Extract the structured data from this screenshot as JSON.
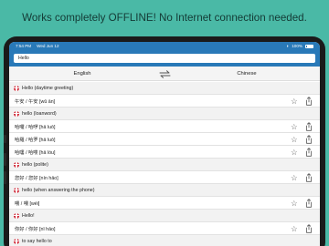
{
  "banner": {
    "text": "Works completely OFFLINE! No Internet connection needed."
  },
  "status": {
    "time": "7:54 PM",
    "date": "Wed Jun 12",
    "battery": "100%"
  },
  "search": {
    "value": "Hello"
  },
  "languages": {
    "source": "English",
    "target": "Chinese"
  },
  "entries": [
    {
      "kind": "header",
      "text": "Hello (daytime greeting)"
    },
    {
      "kind": "entry",
      "text": "午安 / 午安 [wǔ ān]"
    },
    {
      "kind": "header",
      "text": "hello (loanword)"
    },
    {
      "kind": "entry",
      "text": "哈囉 / 哈啰 [hā luō]"
    },
    {
      "kind": "entry",
      "text": "哈羅 / 哈罗 [hā luō]"
    },
    {
      "kind": "entry",
      "text": "哈嘍 / 哈喽 [hā lóu]"
    },
    {
      "kind": "header",
      "text": "hello (polite)"
    },
    {
      "kind": "entry",
      "text": "您好 / 您好 [nín hǎo]"
    },
    {
      "kind": "header",
      "text": "hello (when answering the phone)"
    },
    {
      "kind": "entry",
      "text": "喂 / 喂 [wéi]"
    },
    {
      "kind": "header",
      "text": "Hello!"
    },
    {
      "kind": "entry",
      "text": "你好 / 你好 [nǐ hǎo]"
    },
    {
      "kind": "header",
      "text": "to say hello to"
    }
  ],
  "icons": {
    "favorite": "star-outline-icon",
    "share": "share-icon",
    "swap": "swap-arrows-icon",
    "flag": "uk-flag-icon"
  },
  "colors": {
    "background": "#4ab9a6",
    "toolbar": "#2979b8"
  }
}
